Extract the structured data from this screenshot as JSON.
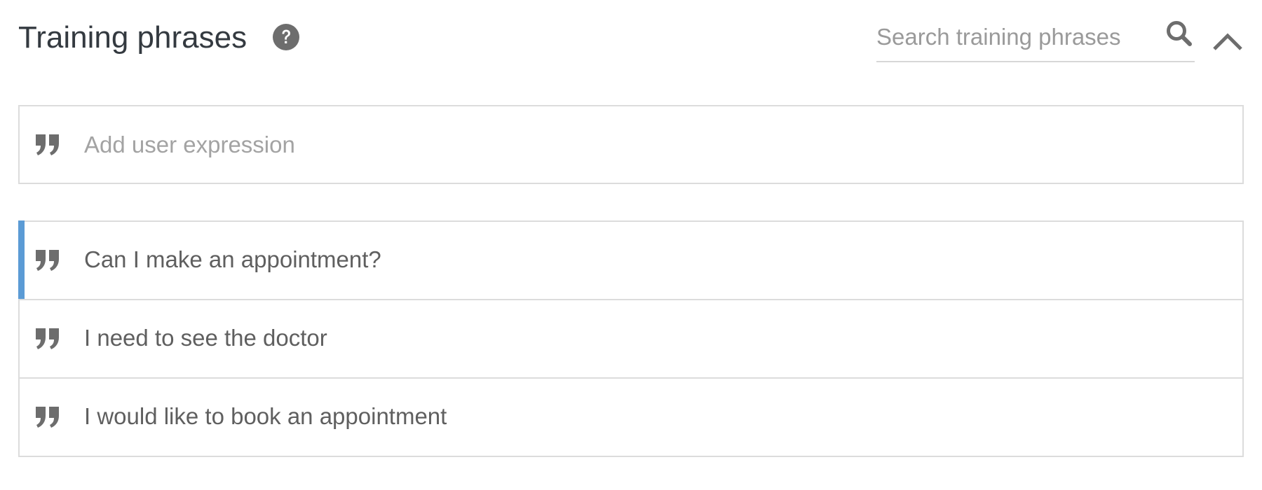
{
  "header": {
    "title": "Training phrases"
  },
  "search": {
    "placeholder": "Search training phrases"
  },
  "add_expression": {
    "placeholder": "Add user expression"
  },
  "phrases": [
    {
      "text": "Can I make an appointment?",
      "active": true
    },
    {
      "text": "I need to see the doctor",
      "active": false
    },
    {
      "text": "I would like to book an appointment",
      "active": false
    }
  ],
  "icons": {
    "help": "help-circle-icon",
    "search": "search-icon",
    "collapse": "chevron-up-icon",
    "quote": "quote-icon"
  },
  "colors": {
    "accent": "#5b9bd5",
    "icon": "#6d6d6d",
    "border": "#dcdcdc",
    "title": "#343a40",
    "text": "#5f5f5f",
    "placeholder": "#a3a3a3"
  }
}
